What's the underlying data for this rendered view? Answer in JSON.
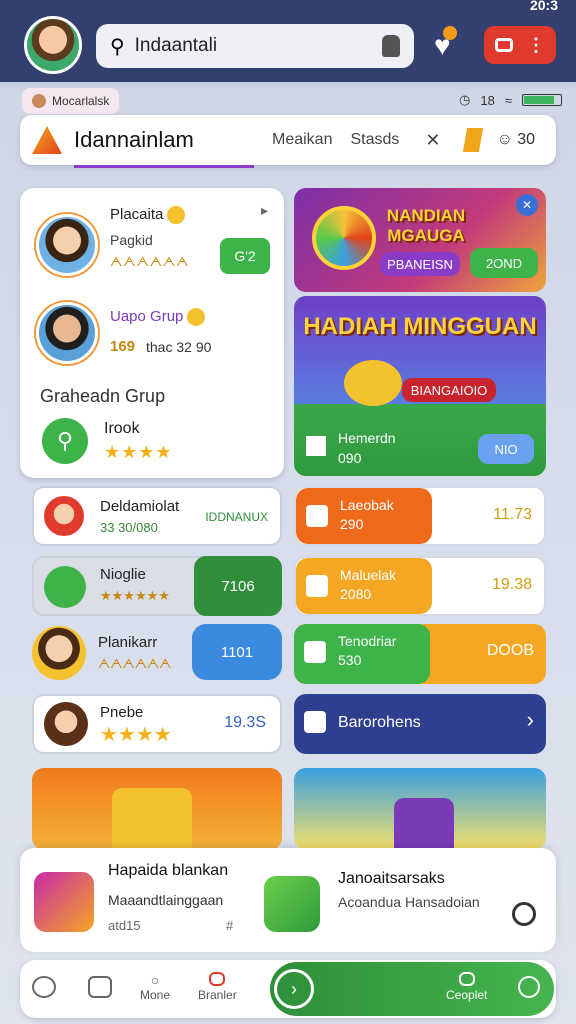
{
  "header": {
    "search_text": "Indaantali",
    "clock": "20:3",
    "notification_chip": "Mocarlalsk",
    "status_text": "18"
  },
  "tabs": {
    "title": "Idannainlam",
    "items": [
      "Meaikan",
      "Stasds"
    ],
    "user_count": "30"
  },
  "left_panel": {
    "player1": {
      "name": "Placaita",
      "sub": "Pagkid",
      "stars": "ᗅᗅᗅᗅᗅᗅ",
      "btn": "G'2"
    },
    "player2": {
      "name": "Uapo Grup",
      "score": "169",
      "detail": "thac 32 90"
    },
    "group_title": "Graheadn Grup",
    "group_sub": "Irook"
  },
  "banners": {
    "b1_title": "NANDIAN MGAUGA",
    "b1_btn": "PBANEISN",
    "b1_btn2": "2OND",
    "b2_title": "HADIAH MINGGUAN",
    "b2_btn": "BIANGAIOIO",
    "b2_label": "Hemerdn",
    "b2_sub": "090",
    "b2_pill": "NIO"
  },
  "left_rows": [
    {
      "name": "Deldamiolat",
      "sub": "33 30/080",
      "right": "IDDNANUX"
    },
    {
      "name": "Nioglie",
      "sub": "★★★★★★",
      "right": "7106"
    },
    {
      "name": "Planikarr",
      "sub": "ᗅᗅᗅᗅᗅᗅ",
      "right": "1101"
    },
    {
      "name": "Pnebe",
      "sub": "★★★★",
      "right": "19.3S"
    }
  ],
  "right_rows": [
    {
      "label": "Laeobak",
      "sub": "290",
      "right": "11.73"
    },
    {
      "label": "Maluelak",
      "sub": "2080",
      "right": "19.38"
    },
    {
      "label": "Tenodriar",
      "sub": "530",
      "right": "DOOB"
    },
    {
      "label": "Barorohens",
      "sub": "",
      "right": "›"
    }
  ],
  "bottom_card": {
    "left_title": "Hapaida blankan",
    "left_sub": "Maaandtlainggaan",
    "left_meta": "atd15",
    "right_title": "Janoaitsarsaks",
    "right_sub": "Acoandua Hansadoian"
  },
  "nav": {
    "more": "Mone",
    "brand": "Branler",
    "coop": "Ceoplet"
  },
  "colors": {
    "accent": "#8a3cc8",
    "green": "#3db34a",
    "orange": "#f36c1f",
    "blue": "#2f3f8f"
  }
}
